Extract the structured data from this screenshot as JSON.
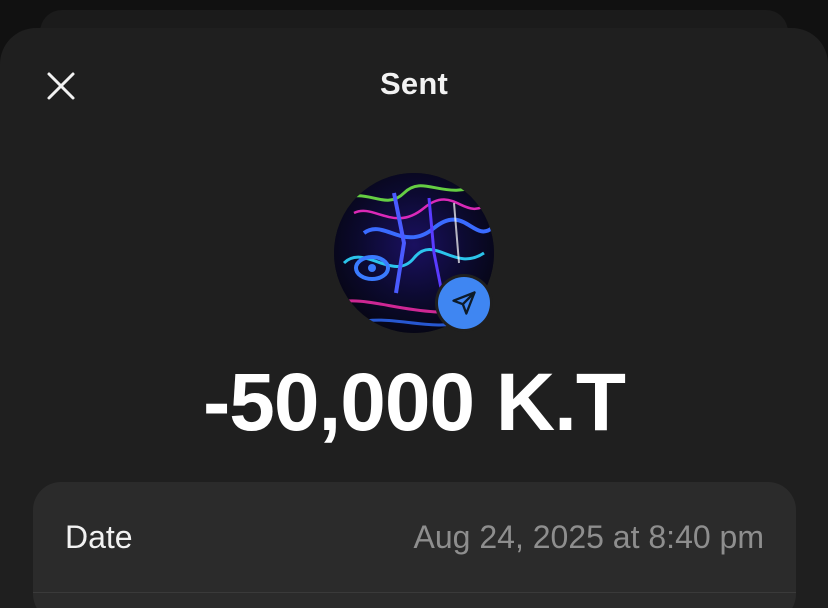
{
  "header": {
    "title": "Sent",
    "close_icon": "close-icon"
  },
  "transaction": {
    "avatar_icon": "user-avatar",
    "status_icon": "send-icon",
    "amount": "-50,000 K.T"
  },
  "details": [
    {
      "label": "Date",
      "value": "Aug 24, 2025 at 8:40 pm"
    }
  ],
  "colors": {
    "background": "#1f1f1f",
    "card": "#2b2b2b",
    "accent": "#3f86f2",
    "muted_text": "#8e8e8e"
  }
}
